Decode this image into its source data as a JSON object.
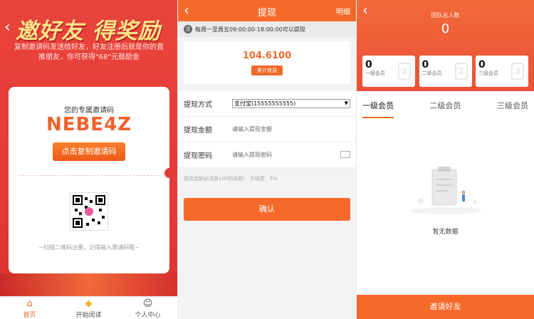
{
  "invite": {
    "hero_title": "邀好友 得奖励",
    "description": "复制邀请码发送给好友，好友注册后就是你的直推朋友，你可获得\"68\"元鼓励金",
    "code_title": "您的专属邀请码",
    "code": "NEBE4Z",
    "copy_button": "点击复制邀请码",
    "qr_hint": "~扫描二维码注册，记得输入邀请码哦~",
    "tabs": [
      {
        "label": "首页",
        "icon": "home-icon"
      },
      {
        "label": "开始阅读",
        "icon": "diamond-icon"
      },
      {
        "label": "个人中心",
        "icon": "user-icon"
      }
    ]
  },
  "withdraw": {
    "title": "提现",
    "detail_link": "明细",
    "notice_tag": "注",
    "notice": "每周一至周五09:00:00-18:00:00可以提现",
    "balance": "104.6100",
    "balance_label": "累计收益",
    "method_label": "提现方式",
    "method_value": "支付宝(15555555555)",
    "amount_label": "提现金额",
    "amount_placeholder": "请输入提现金额",
    "password_label": "提现密码",
    "password_placeholder": "请输入提现密码",
    "hint": "提现金额必须是100的倍数！ 手续费：5%",
    "confirm": "确认"
  },
  "team": {
    "total_label": "团队总人数",
    "total_value": "0",
    "levels": [
      {
        "count": "0",
        "name": "一级会员",
        "badge": "1"
      },
      {
        "count": "0",
        "name": "二级会员",
        "badge": "2"
      },
      {
        "count": "0",
        "name": "三级会员",
        "badge": "3"
      }
    ],
    "tabs": [
      "一级会员",
      "二级会员",
      "三级会员"
    ],
    "empty_text": "暂无数据",
    "invite_button": "邀请好友"
  },
  "colors": {
    "accent": "#f56a2a",
    "invite_red": "#e43b3a",
    "code_orange": "#f0612a"
  }
}
